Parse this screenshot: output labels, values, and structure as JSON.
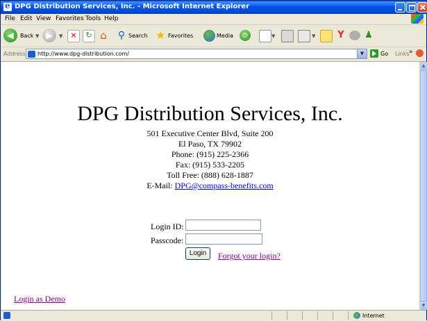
{
  "window": {
    "title": "DPG Distribution Services, Inc. - Microsoft Internet Explorer"
  },
  "menu": [
    "File",
    "Edit",
    "View",
    "Favorites",
    "Tools",
    "Help"
  ],
  "toolbar": {
    "back_label": "Back",
    "search_label": "Search",
    "favorites_label": "Favorites",
    "media_label": "Media"
  },
  "address": {
    "label": "Address",
    "url": "http://www.dpg-distribution.com/",
    "go_label": "Go",
    "links_label": "Links"
  },
  "page": {
    "company": "DPG Distribution Services, Inc.",
    "address_line1": "501 Executive Center Blvd, Suite 200",
    "address_line2": "El Paso, TX 79902",
    "phone": "Phone: (915) 225-2366",
    "fax": "Fax: (915) 533-2205",
    "tollfree": "Toll Free: (888) 628-1887",
    "email_label": "E-Mail:",
    "email": "DPG@compass-benefits.com",
    "login_id_label": "Login ID:",
    "passcode_label": "Passcode:",
    "login_id_value": "",
    "passcode_value": "",
    "login_button": "Login",
    "forgot_link": "Forgot your login?",
    "demo_link": "Login as Demo"
  },
  "status": {
    "zone": "Internet"
  },
  "colors": {
    "titlebar": "#0055e5",
    "link_unvisited": "#0000ee",
    "link_visited": "#800080"
  }
}
